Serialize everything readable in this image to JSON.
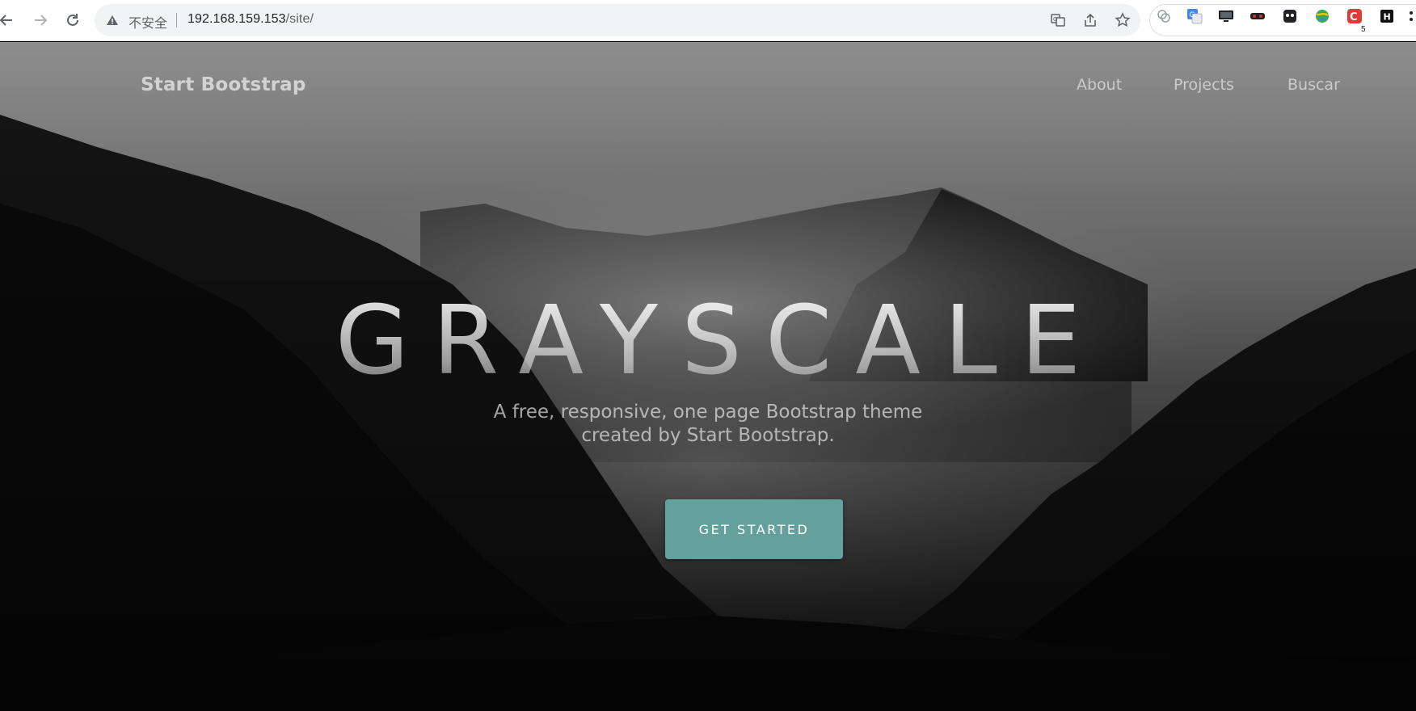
{
  "browser": {
    "security_label": "不安全",
    "url_host": "192.168.159.153",
    "url_path": "/site/",
    "extension_badge": "5"
  },
  "site": {
    "brand": "Start Bootstrap",
    "nav": [
      "About",
      "Projects",
      "Buscar"
    ],
    "title": "GRAYSCALE",
    "subtitle_line1": "A free, responsive, one page Bootstrap theme",
    "subtitle_line2": "created by Start Bootstrap.",
    "cta_label": "GET STARTED"
  },
  "colors": {
    "cta": "#64a19d",
    "chrome_bg": "#ffffff",
    "omnibox_bg": "#f1f3f4"
  }
}
